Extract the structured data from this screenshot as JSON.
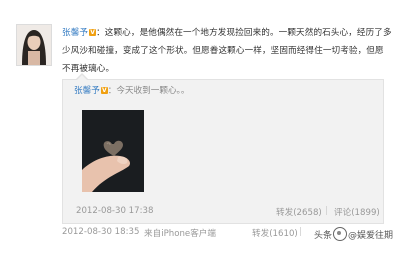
{
  "post": {
    "author": "张馨予",
    "text": "：这颗心，是他偶然在一个地方发现捡回来的。一颗天然的石头心，经历了多少风沙和碰撞，变成了这个形状。但愿眷这颗心一样，坚固而经得住一切考验，但愿不再被璃心。",
    "time": "2012-08-30 18:35",
    "source": "来自iPhone客户端",
    "repost": "转发(1610)",
    "separator": "|"
  },
  "retweet": {
    "author": "张馨予",
    "text": "：今天收到一颗心。。",
    "time": "2012-08-30 17:38",
    "repost": "转发(2658)",
    "separator": "|",
    "comment": "评论(1899)"
  },
  "watermark": {
    "prefix": "头条",
    "account": "@娱爱往期"
  },
  "badge": {
    "verified": "V",
    "color": "#f0a011"
  },
  "colors": {
    "link": "#3a7fc4",
    "meta": "#999999",
    "retweet_bg": "#f2f2f2"
  }
}
